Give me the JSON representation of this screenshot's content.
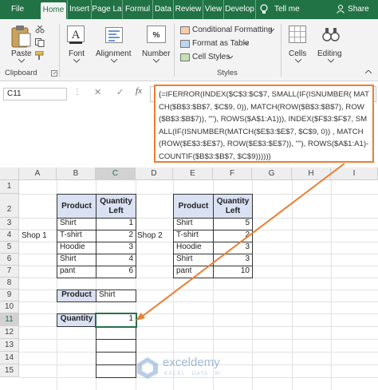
{
  "tabs": [
    "File",
    "Home",
    "Insert",
    "Page La",
    "Formul",
    "Data",
    "Review",
    "View",
    "Develop"
  ],
  "active_tab": "Home",
  "tell_me": "Tell me",
  "share": "Share",
  "ribbon": {
    "paste": "Paste",
    "font": "Font",
    "alignment": "Alignment",
    "number": "Number",
    "conditional_formatting": "Conditional Formatting",
    "format_as_table": "Format as Table",
    "cell_styles": "Cell Styles",
    "cells": "Cells",
    "editing": "Editing",
    "group_clipboard": "Clipboard",
    "group_styles": "Styles"
  },
  "namebox": "C11",
  "formula": "{=IFERROR(INDEX($C$3:$C$7, SMALL(IF(ISNUMBER( MATCH($B$3:$B$7, $C$9, 0)), MATCH(ROW($B$3:$B$7), ROW($B$3:$B$7)), \"\"), ROWS($A$1:A1))), INDEX($F$3:$F$7, SMALL(IF(ISNUMBER(MATCH($E$3:$E$7, $C$9, 0)) , MATCH(ROW($E$3:$E$7), ROW($E$3:$E$7)), \"\"), ROWS($A$1:A1)-COUNTIF($B$3:$B$7, $C$9)))))}",
  "columns": [
    "A",
    "B",
    "C",
    "D",
    "E",
    "F",
    "G",
    "H",
    "I"
  ],
  "rows": [
    "1",
    "2",
    "3",
    "4",
    "5",
    "6",
    "7",
    "8",
    "9",
    "10",
    "11",
    "12",
    "13",
    "14",
    "15"
  ],
  "shop1": {
    "label": "Shop 1",
    "headers": [
      "Product",
      "Quantity Left"
    ],
    "rows": [
      [
        "Shirt",
        "1"
      ],
      [
        "T-shirt",
        "2"
      ],
      [
        "Hoodie",
        "3"
      ],
      [
        "Shirt",
        "4"
      ],
      [
        "pant",
        "6"
      ]
    ]
  },
  "shop2": {
    "label": "Shop 2",
    "headers": [
      "Product",
      "Quantity Left"
    ],
    "rows": [
      [
        "Shirt",
        "5"
      ],
      [
        "T-shirt",
        "2"
      ],
      [
        "Hoodie",
        "3"
      ],
      [
        "Shirt",
        "3"
      ],
      [
        "pant",
        "10"
      ]
    ]
  },
  "lookup": {
    "label": "Product",
    "value": "Shirt"
  },
  "result": {
    "label": "Quantity",
    "values": [
      "1",
      "",
      "",
      "",
      ""
    ]
  },
  "watermark": {
    "name": "exceldemy",
    "tagline": "EXCEL · DATA · BI"
  },
  "colors": {
    "excel_green": "#217346",
    "header_fill": "#d9e1f2",
    "callout_border": "#ed7d31"
  }
}
